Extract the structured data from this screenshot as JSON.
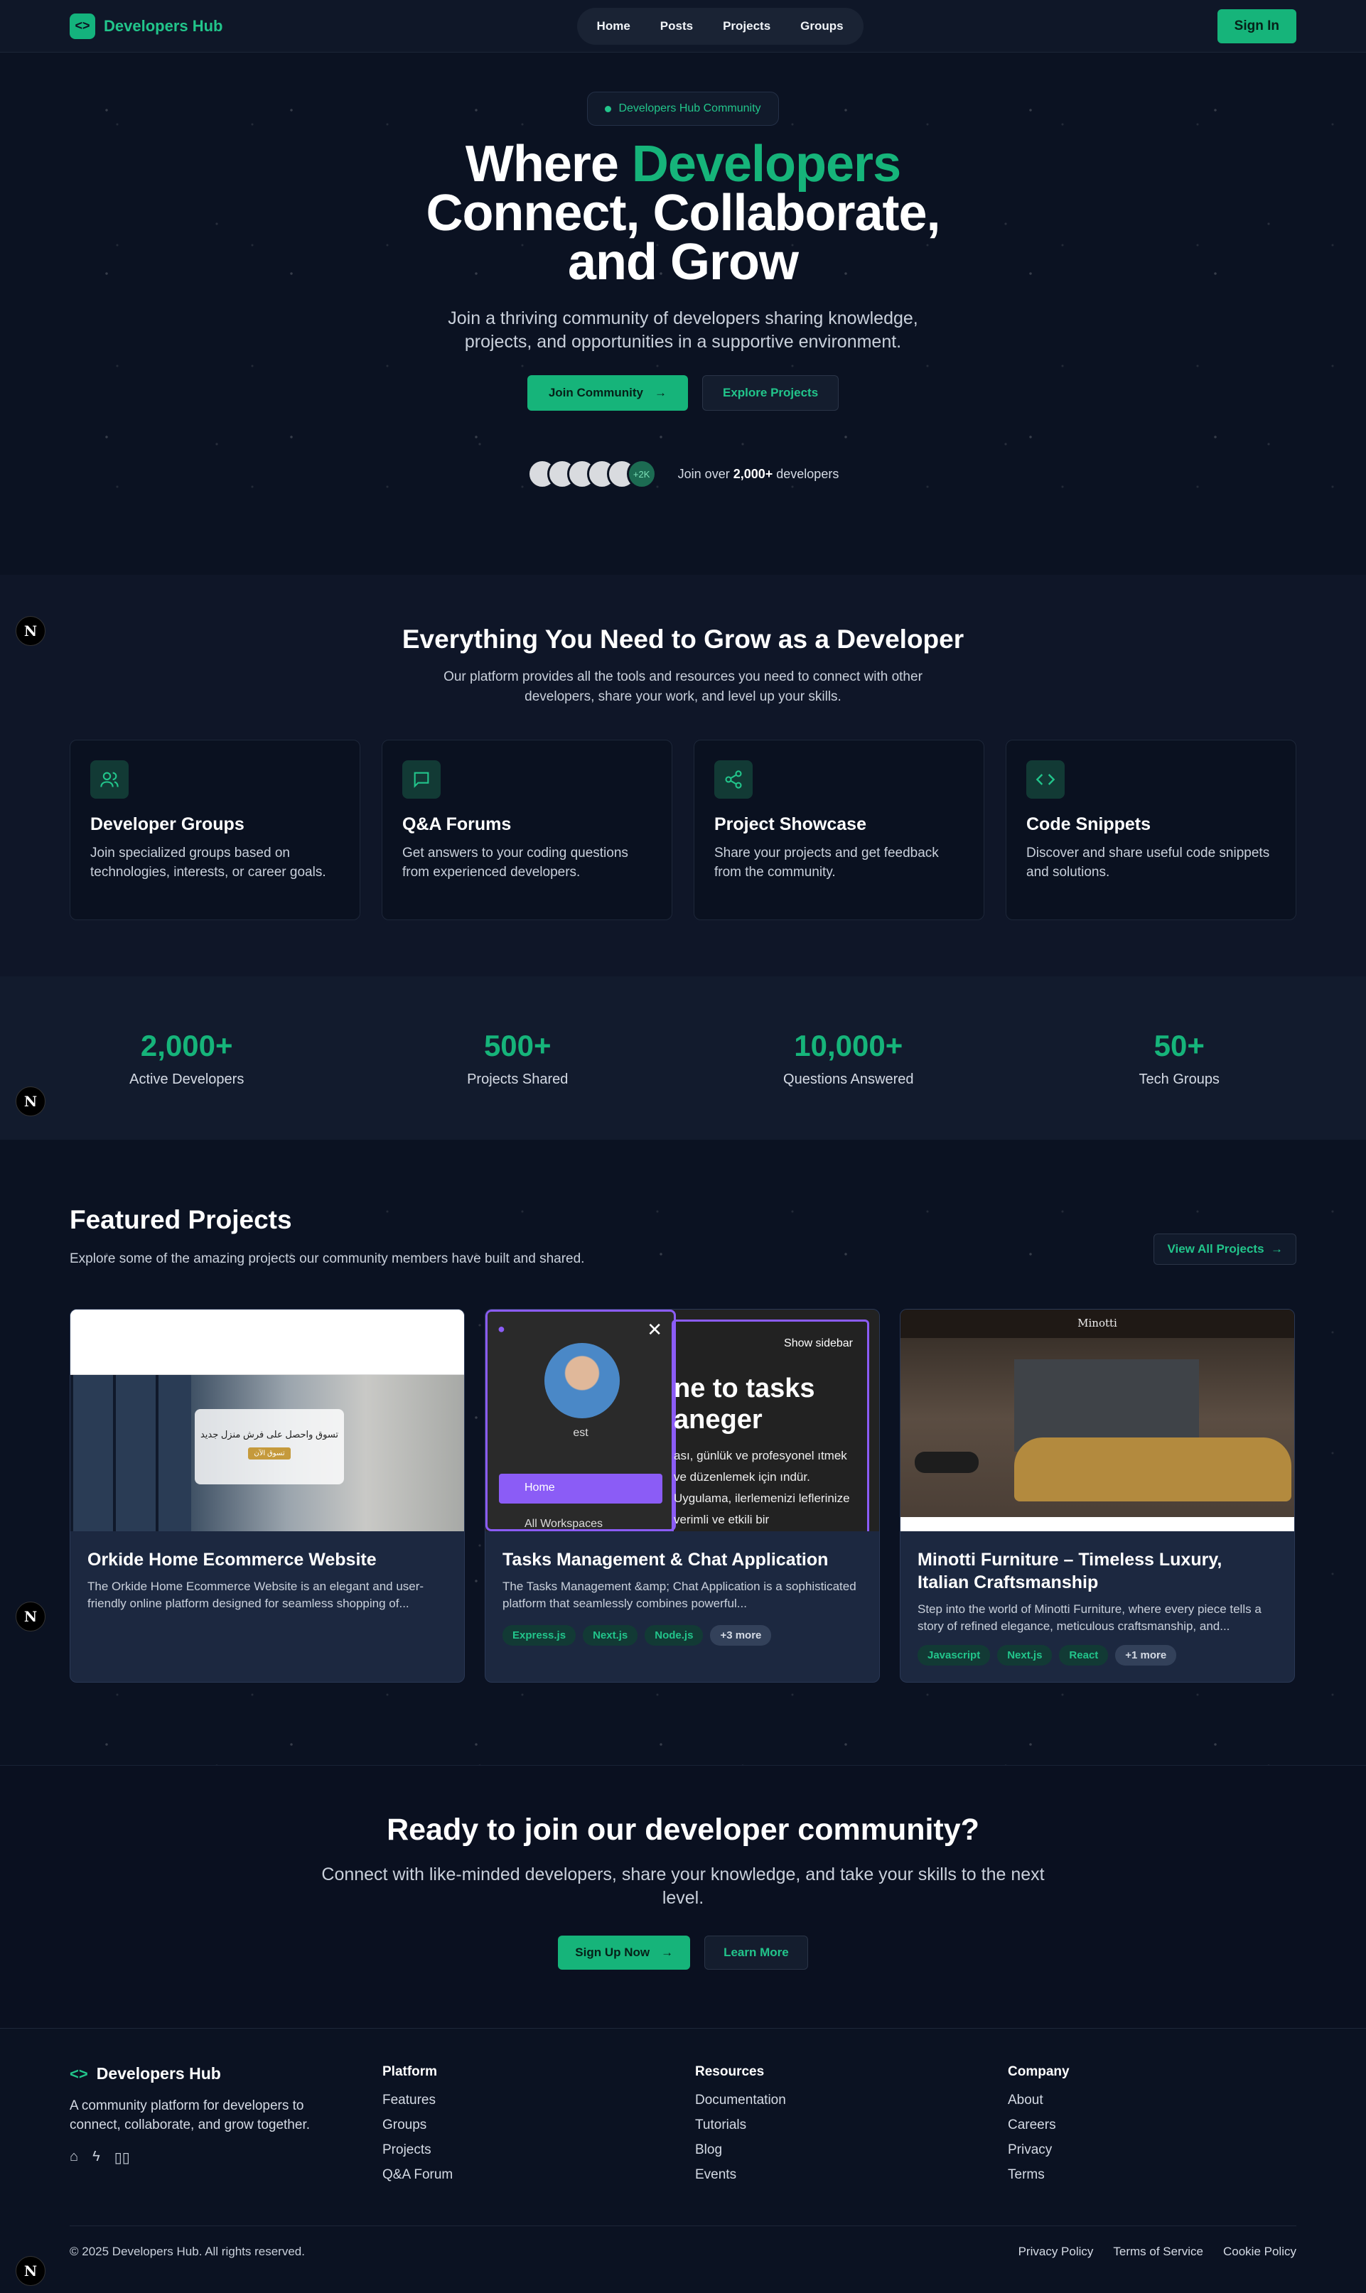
{
  "nav": {
    "brand": "Developers Hub",
    "links": [
      "Home",
      "Posts",
      "Projects",
      "Groups"
    ],
    "signin": "Sign In"
  },
  "hero": {
    "pill": "Developers Hub Community",
    "title_a": "Where ",
    "title_accent": "Developers",
    "title_b": "Connect, Collaborate,",
    "title_c": "and Grow",
    "lead": "Join a thriving community of developers sharing knowledge, projects, and opportunities in a supportive environment.",
    "join_btn": "Join Community",
    "explore_btn": "Explore Projects",
    "avatar_more": "+2K",
    "avatar_text_a": "Join over ",
    "avatar_text_b": "2,000+",
    "avatar_text_c": " developers"
  },
  "features": {
    "title": "Everything You Need to Grow as a Developer",
    "subtitle": "Our platform provides all the tools and resources you need to connect with other developers, share your work, and level up your skills.",
    "cards": [
      {
        "icon": "users-icon",
        "title": "Developer Groups",
        "desc": "Join specialized groups based on technologies, interests, or career goals."
      },
      {
        "icon": "chat-icon",
        "title": "Q&A Forums",
        "desc": "Get answers to your coding questions from experienced developers."
      },
      {
        "icon": "share-icon",
        "title": "Project Showcase",
        "desc": "Share your projects and get feedback from the community."
      },
      {
        "icon": "code-icon",
        "title": "Code Snippets",
        "desc": "Discover and share useful code snippets and solutions."
      }
    ]
  },
  "stats": [
    {
      "num": "2,000+",
      "label": "Active Developers"
    },
    {
      "num": "500+",
      "label": "Projects Shared"
    },
    {
      "num": "10,000+",
      "label": "Questions Answered"
    },
    {
      "num": "50+",
      "label": "Tech Groups"
    }
  ],
  "projects": {
    "title": "Featured Projects",
    "subtitle": "Explore some of the amazing projects our community members have built and shared.",
    "view_all": "View All Projects",
    "items": [
      {
        "title": "Orkide Home Ecommerce Website",
        "desc": "The Orkide Home Ecommerce Website is an elegant and user-friendly online platform designed for seamless shopping of...",
        "tags": []
      },
      {
        "title": "Tasks Management & Chat Application",
        "desc": "The Tasks Management &amp; Chat Application is a sophisticated platform that seamlessly combines powerful...",
        "tags": [
          "Express.js",
          "Next.js",
          "Node.js",
          "+3 more"
        ]
      },
      {
        "title": "Minotti Furniture – Timeless Luxury, Italian Craftsmanship",
        "desc": "Step into the world of Minotti Furniture, where every piece tells a story of refined elegance, meticulous craftsmanship, and...",
        "tags": [
          "Javascript",
          "Next.js",
          "React",
          "+1 more"
        ]
      }
    ],
    "shot1": {
      "banner": "تسوق واحصل على فرش منزل جديد",
      "btn": "تسوق الآن"
    },
    "shot2": {
      "user": "est",
      "home": "Home",
      "workspaces": "All Workspaces",
      "show_sidebar": "Show sidebar",
      "heading_a": "ne to tasks",
      "heading_b": "aneger",
      "body": "ası, günlük ve profesyonel ıtmek ve düzenlemek için ındür. Uygulama, ilerlemenizi leflerinize verimli ve etkili bir"
    },
    "shot3": {
      "logo": "Minotti"
    }
  },
  "cta": {
    "title": "Ready to join our developer community?",
    "text": "Connect with like-minded developers, share your knowledge, and take your skills to the next level.",
    "signup": "Sign Up Now",
    "learn": "Learn More"
  },
  "footer": {
    "brand": "Developers Hub",
    "desc": "A community platform for developers to connect, collaborate, and grow together.",
    "cols": [
      {
        "title": "Platform",
        "links": [
          "Features",
          "Groups",
          "Projects",
          "Q&A Forum"
        ]
      },
      {
        "title": "Resources",
        "links": [
          "Documentation",
          "Tutorials",
          "Blog",
          "Events"
        ]
      },
      {
        "title": "Company",
        "links": [
          "About",
          "Careers",
          "Privacy",
          "Terms"
        ]
      }
    ],
    "copyright": "© 2025 Developers Hub. All rights reserved.",
    "legal": [
      "Privacy Policy",
      "Terms of Service",
      "Cookie Policy"
    ]
  }
}
